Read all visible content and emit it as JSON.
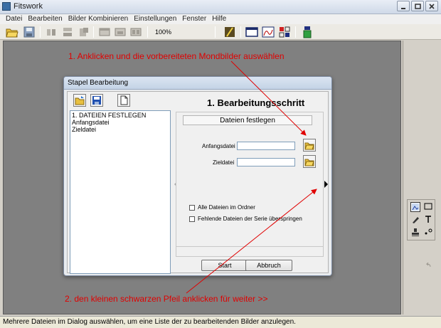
{
  "app": {
    "title": "Fitswork"
  },
  "menu": [
    "Datei",
    "Bearbeiten",
    "Bilder Kombinieren",
    "Einstellungen",
    "Fenster",
    "Hilfe"
  ],
  "toolbar": {
    "zoom": "100%"
  },
  "annotations": {
    "top": "1. Anklicken und die vorbereiteten Mondbilder auswählen",
    "bottom": "2. den kleinen schwarzen Pfeil anklicken für weiter >>",
    "color": "#e00000"
  },
  "dialog": {
    "title": "Stapel Bearbeitung",
    "step_title": "1. Bearbeitungsschritt",
    "steps": [
      "1. DATEIEN FESTLEGEN",
      "Anfangsdatei",
      "Zieldatei"
    ],
    "panel_header": "Dateien festlegen",
    "start_label": "Anfangsdatei",
    "start_value": "",
    "target_label": "Zieldatei",
    "target_value": "",
    "check_all": "Alle Dateien im Ordner",
    "check_skip": "Fehlende Dateien der Serie überspringen",
    "btn_start": "Start",
    "btn_cancel": "Abbruch"
  },
  "status": "Mehrere Dateien im Dialog auswählen, um eine Liste der zu bearbeitenden Bilder anzulegen."
}
